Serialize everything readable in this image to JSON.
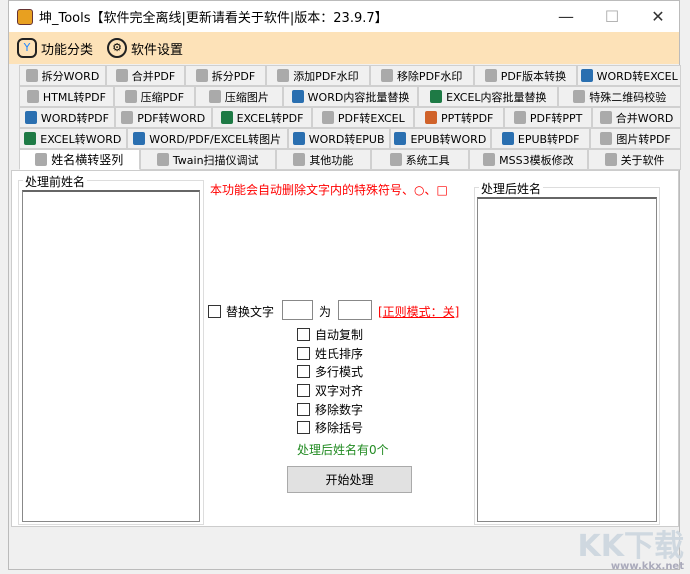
{
  "window": {
    "title": "坤_Tools【软件完全离线|更新请看关于软件|版本：23.9.7】",
    "minimize": "—",
    "maximize": "☐",
    "close": "✕"
  },
  "menu": [
    {
      "label": "功能分类",
      "icon": "filter-icon"
    },
    {
      "label": "软件设置",
      "icon": "gear-icon"
    }
  ],
  "tab_rows": [
    [
      "拆分WORD",
      "合并PDF",
      "拆分PDF",
      "添加PDF水印",
      "移除PDF水印",
      "PDF版本转换",
      "WORD转EXCEL"
    ],
    [
      "HTML转PDF",
      "压缩PDF",
      "压缩图片",
      "WORD内容批量替换",
      "EXCEL内容批量替换",
      "特殊二维码校验"
    ],
    [
      "WORD转PDF",
      "PDF转WORD",
      "EXCEL转PDF",
      "PDF转EXCEL",
      "PPT转PDF",
      "PDF转PPT",
      "合并WORD"
    ],
    [
      "EXCEL转WORD",
      "WORD/PDF/EXCEL转图片",
      "WORD转EPUB",
      "EPUB转WORD",
      "EPUB转PDF",
      "图片转PDF"
    ],
    [
      "姓名横转竖列",
      "Twain扫描仪调试",
      "其他功能",
      "系统工具",
      "MSS3模板修改",
      "关于软件"
    ]
  ],
  "selected_tab": "姓名横转竖列",
  "panel": {
    "before_label": "处理前姓名",
    "after_label": "处理后姓名",
    "notice": "本功能会自动删除文字内的特殊符号、○、□",
    "replace_label": "替换文字",
    "replace_from": "",
    "to_label": "为",
    "replace_to": "",
    "regex_link": "[正则模式：关]",
    "options": [
      "自动复制",
      "姓氏排序",
      "多行模式",
      "双字对齐",
      "移除数字",
      "移除括号"
    ],
    "count_text": "处理后姓名有0个",
    "start_button": "开始处理"
  },
  "watermark": {
    "text": "KK下载",
    "url": "www.kkx.net"
  }
}
